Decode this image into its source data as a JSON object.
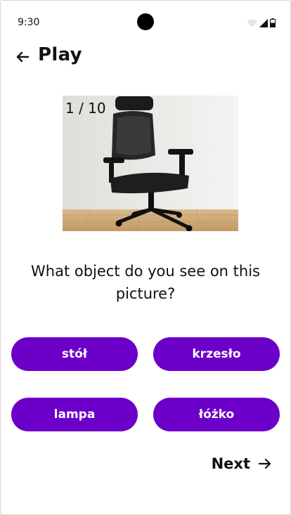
{
  "status_bar": {
    "time": "9:30",
    "icons": [
      "wifi-icon",
      "signal-icon",
      "battery-icon"
    ]
  },
  "header": {
    "title": "Play",
    "back_icon": "arrow-left-icon"
  },
  "quiz": {
    "progress": "1 / 10",
    "question": "What object do you see on this picture?",
    "image_subject": "office chair",
    "answers": [
      "stół",
      "krzesło",
      "lampa",
      "łóżko"
    ],
    "next_label": "Next",
    "next_icon": "arrow-right-icon"
  },
  "colors": {
    "accent": "#6c00c8",
    "background": "#ffffff"
  }
}
